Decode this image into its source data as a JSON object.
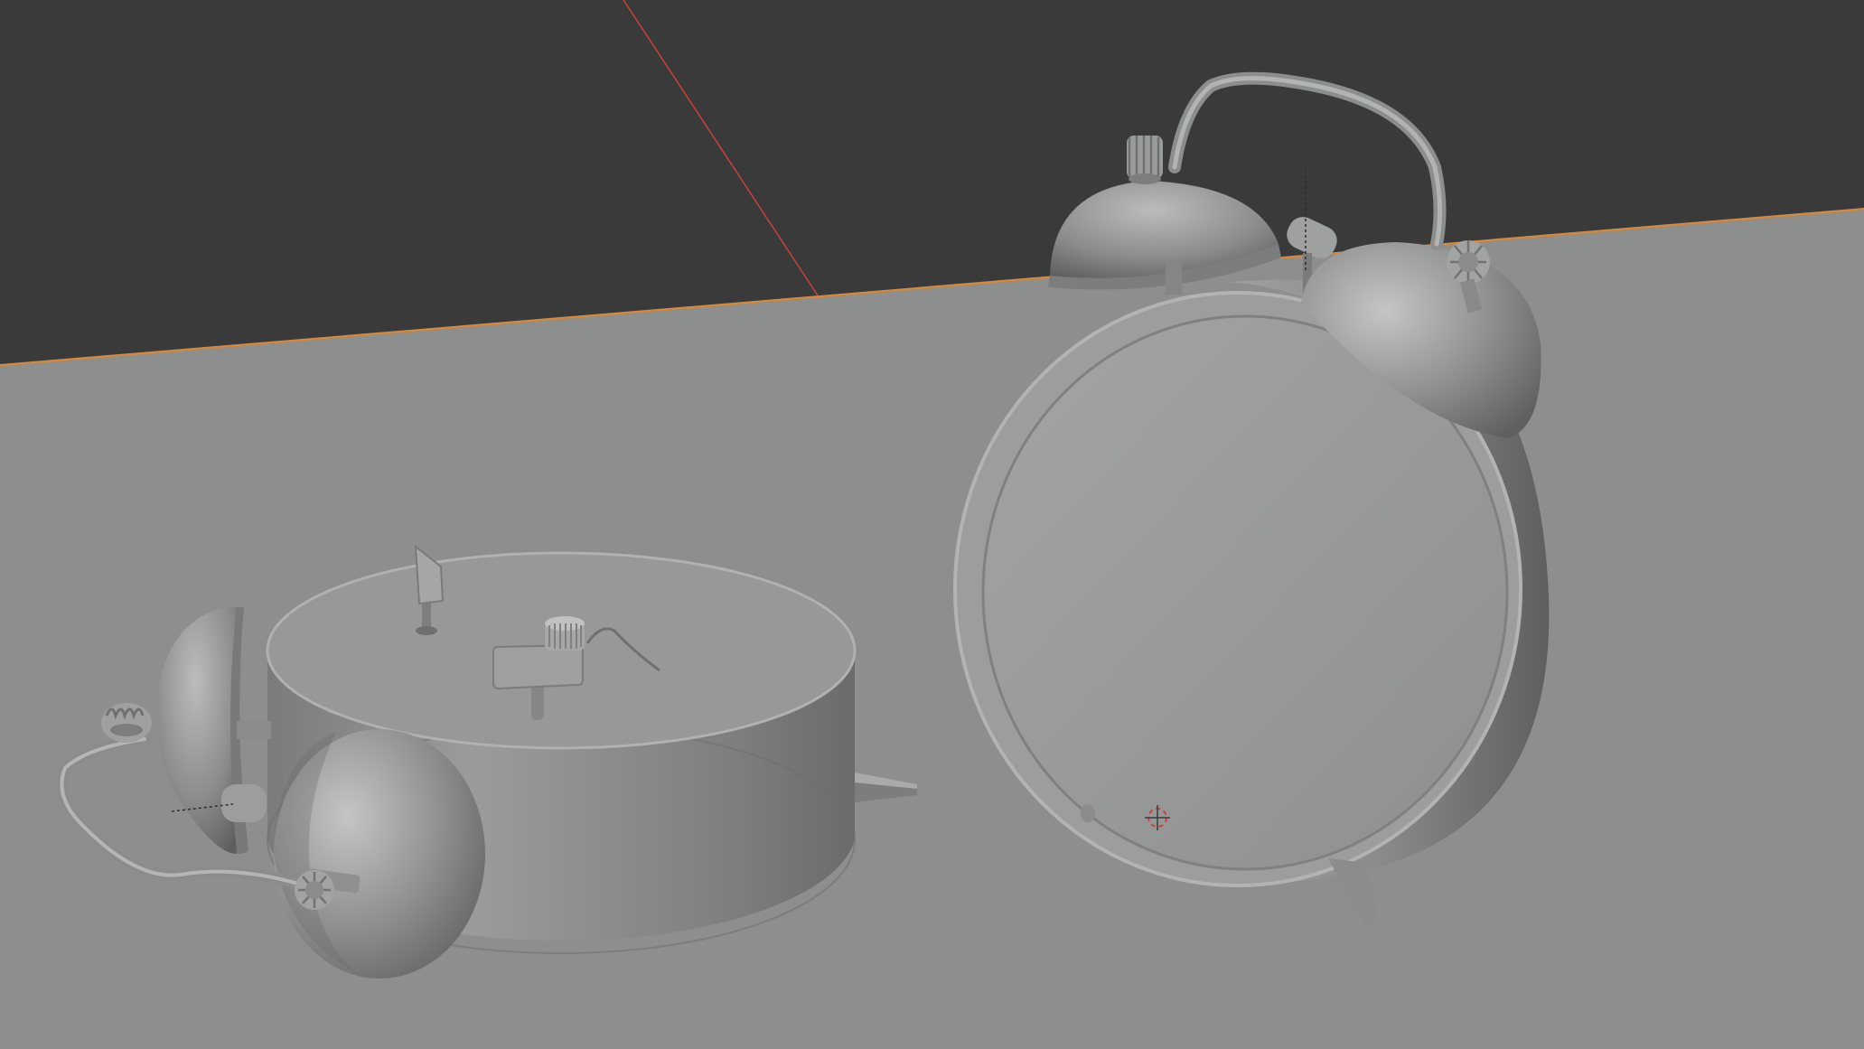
{
  "app": "3D viewport",
  "scene": {
    "objects": [
      "alarm-clock-lying",
      "alarm-clock-standing"
    ],
    "background_color": "#3a3a3a",
    "floor_color": "#8d8e8e",
    "horizon_line_color": "#e0882a",
    "x_axis_color": "#c9413b",
    "model_color": "#8a8b8b",
    "shading": "solid"
  }
}
